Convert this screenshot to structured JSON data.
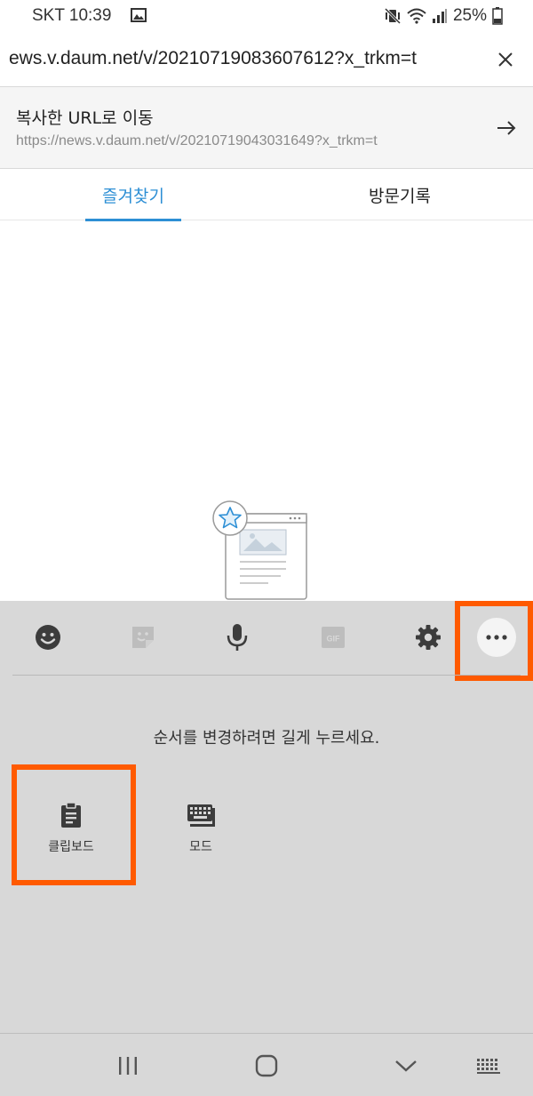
{
  "status_bar": {
    "carrier_time": "SKT 10:39",
    "battery": "25%"
  },
  "url_bar": {
    "value": "ews.v.daum.net/v/20210719083607612?x_trkm=t"
  },
  "copied_url": {
    "title": "복사한 URL로 이동",
    "url": "https://news.v.daum.net/v/20210719043031649?x_trkm=t"
  },
  "tabs": [
    {
      "label": "즐겨찾기",
      "active": true
    },
    {
      "label": "방문기록",
      "active": false
    }
  ],
  "keyboard_panel": {
    "hint": "순서를 변경하려면 길게 누르세요.",
    "options": [
      {
        "label": "클립보드",
        "icon": "clipboard-icon"
      },
      {
        "label": "모드",
        "icon": "keyboard-mode-icon"
      }
    ],
    "toolbar_icons": [
      "emoji-icon",
      "sticker-icon",
      "microphone-icon",
      "gif-icon",
      "settings-icon",
      "more-icon"
    ]
  },
  "colors": {
    "accent": "#2d8fd5",
    "highlight": "#ff5a00",
    "panel_bg": "#d8d8d8"
  }
}
